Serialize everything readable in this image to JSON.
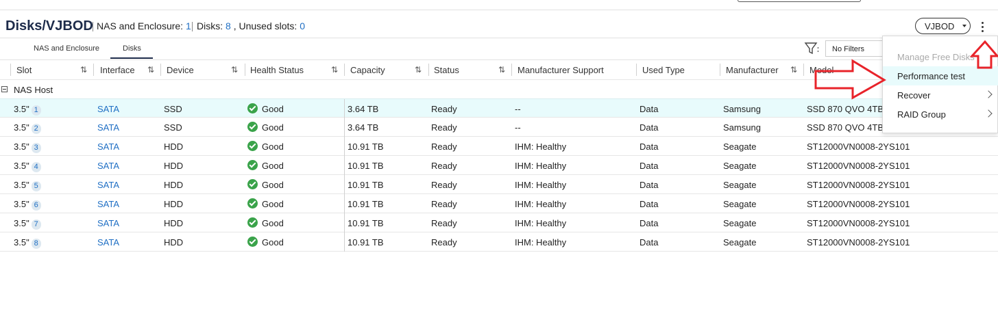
{
  "header": {
    "title": "Disks/VJBOD",
    "nas_label": "NAS and Enclosure:",
    "nas_count": "1",
    "disks_label": "Disks:",
    "disks_count": "8",
    "unused_label": ", Unused slots:",
    "unused_count": "0",
    "vjbod_button": "VJBOD"
  },
  "tabs": [
    {
      "label": "NAS and Enclosure",
      "active": false
    },
    {
      "label": "Disks",
      "active": true
    }
  ],
  "filter": {
    "value": "No Filters"
  },
  "columns": [
    "Slot",
    "Interface",
    "Device",
    "Health Status",
    "Capacity",
    "Status",
    "Manufacturer Support",
    "Used Type",
    "Manufacturer",
    "Model"
  ],
  "group": {
    "label": "NAS Host"
  },
  "rows": [
    {
      "slot": "3.5\"",
      "slot_num": "1",
      "interface": "SATA",
      "device": "SSD",
      "health": "Good",
      "capacity": "3.64 TB",
      "status": "Ready",
      "support": "--",
      "used_type": "Data",
      "manufacturer": "Samsung",
      "model": "SSD 870 QVO 4TB"
    },
    {
      "slot": "3.5\"",
      "slot_num": "2",
      "interface": "SATA",
      "device": "SSD",
      "health": "Good",
      "capacity": "3.64 TB",
      "status": "Ready",
      "support": "--",
      "used_type": "Data",
      "manufacturer": "Samsung",
      "model": "SSD 870 QVO 4TB"
    },
    {
      "slot": "3.5\"",
      "slot_num": "3",
      "interface": "SATA",
      "device": "HDD",
      "health": "Good",
      "capacity": "10.91 TB",
      "status": "Ready",
      "support": "IHM: Healthy",
      "used_type": "Data",
      "manufacturer": "Seagate",
      "model": "ST12000VN0008-2YS101"
    },
    {
      "slot": "3.5\"",
      "slot_num": "4",
      "interface": "SATA",
      "device": "HDD",
      "health": "Good",
      "capacity": "10.91 TB",
      "status": "Ready",
      "support": "IHM: Healthy",
      "used_type": "Data",
      "manufacturer": "Seagate",
      "model": "ST12000VN0008-2YS101"
    },
    {
      "slot": "3.5\"",
      "slot_num": "5",
      "interface": "SATA",
      "device": "HDD",
      "health": "Good",
      "capacity": "10.91 TB",
      "status": "Ready",
      "support": "IHM: Healthy",
      "used_type": "Data",
      "manufacturer": "Seagate",
      "model": "ST12000VN0008-2YS101"
    },
    {
      "slot": "3.5\"",
      "slot_num": "6",
      "interface": "SATA",
      "device": "HDD",
      "health": "Good",
      "capacity": "10.91 TB",
      "status": "Ready",
      "support": "IHM: Healthy",
      "used_type": "Data",
      "manufacturer": "Seagate",
      "model": "ST12000VN0008-2YS101"
    },
    {
      "slot": "3.5\"",
      "slot_num": "7",
      "interface": "SATA",
      "device": "HDD",
      "health": "Good",
      "capacity": "10.91 TB",
      "status": "Ready",
      "support": "IHM: Healthy",
      "used_type": "Data",
      "manufacturer": "Seagate",
      "model": "ST12000VN0008-2YS101"
    },
    {
      "slot": "3.5\"",
      "slot_num": "8",
      "interface": "SATA",
      "device": "HDD",
      "health": "Good",
      "capacity": "10.91 TB",
      "status": "Ready",
      "support": "IHM: Healthy",
      "used_type": "Data",
      "manufacturer": "Seagate",
      "model": "ST12000VN0008-2YS101"
    }
  ],
  "menu": {
    "items": [
      {
        "label": "Manage Free Disks",
        "disabled": true
      },
      {
        "label": "Performance test",
        "highlighted": true
      },
      {
        "label": "Recover",
        "submenu": true
      },
      {
        "label": "RAID Group",
        "submenu": true
      }
    ]
  },
  "colors": {
    "accent": "#1f6fc4",
    "title": "#1d2b4a",
    "selected_row": "#e8fbfc",
    "good": "#3aa34a",
    "annotation_arrow": "#e8232a"
  },
  "icons": [
    "filter-icon",
    "kebab-menu-icon",
    "sort-icon",
    "check-circle-icon",
    "chevron-right-icon",
    "collapse-icon"
  ]
}
